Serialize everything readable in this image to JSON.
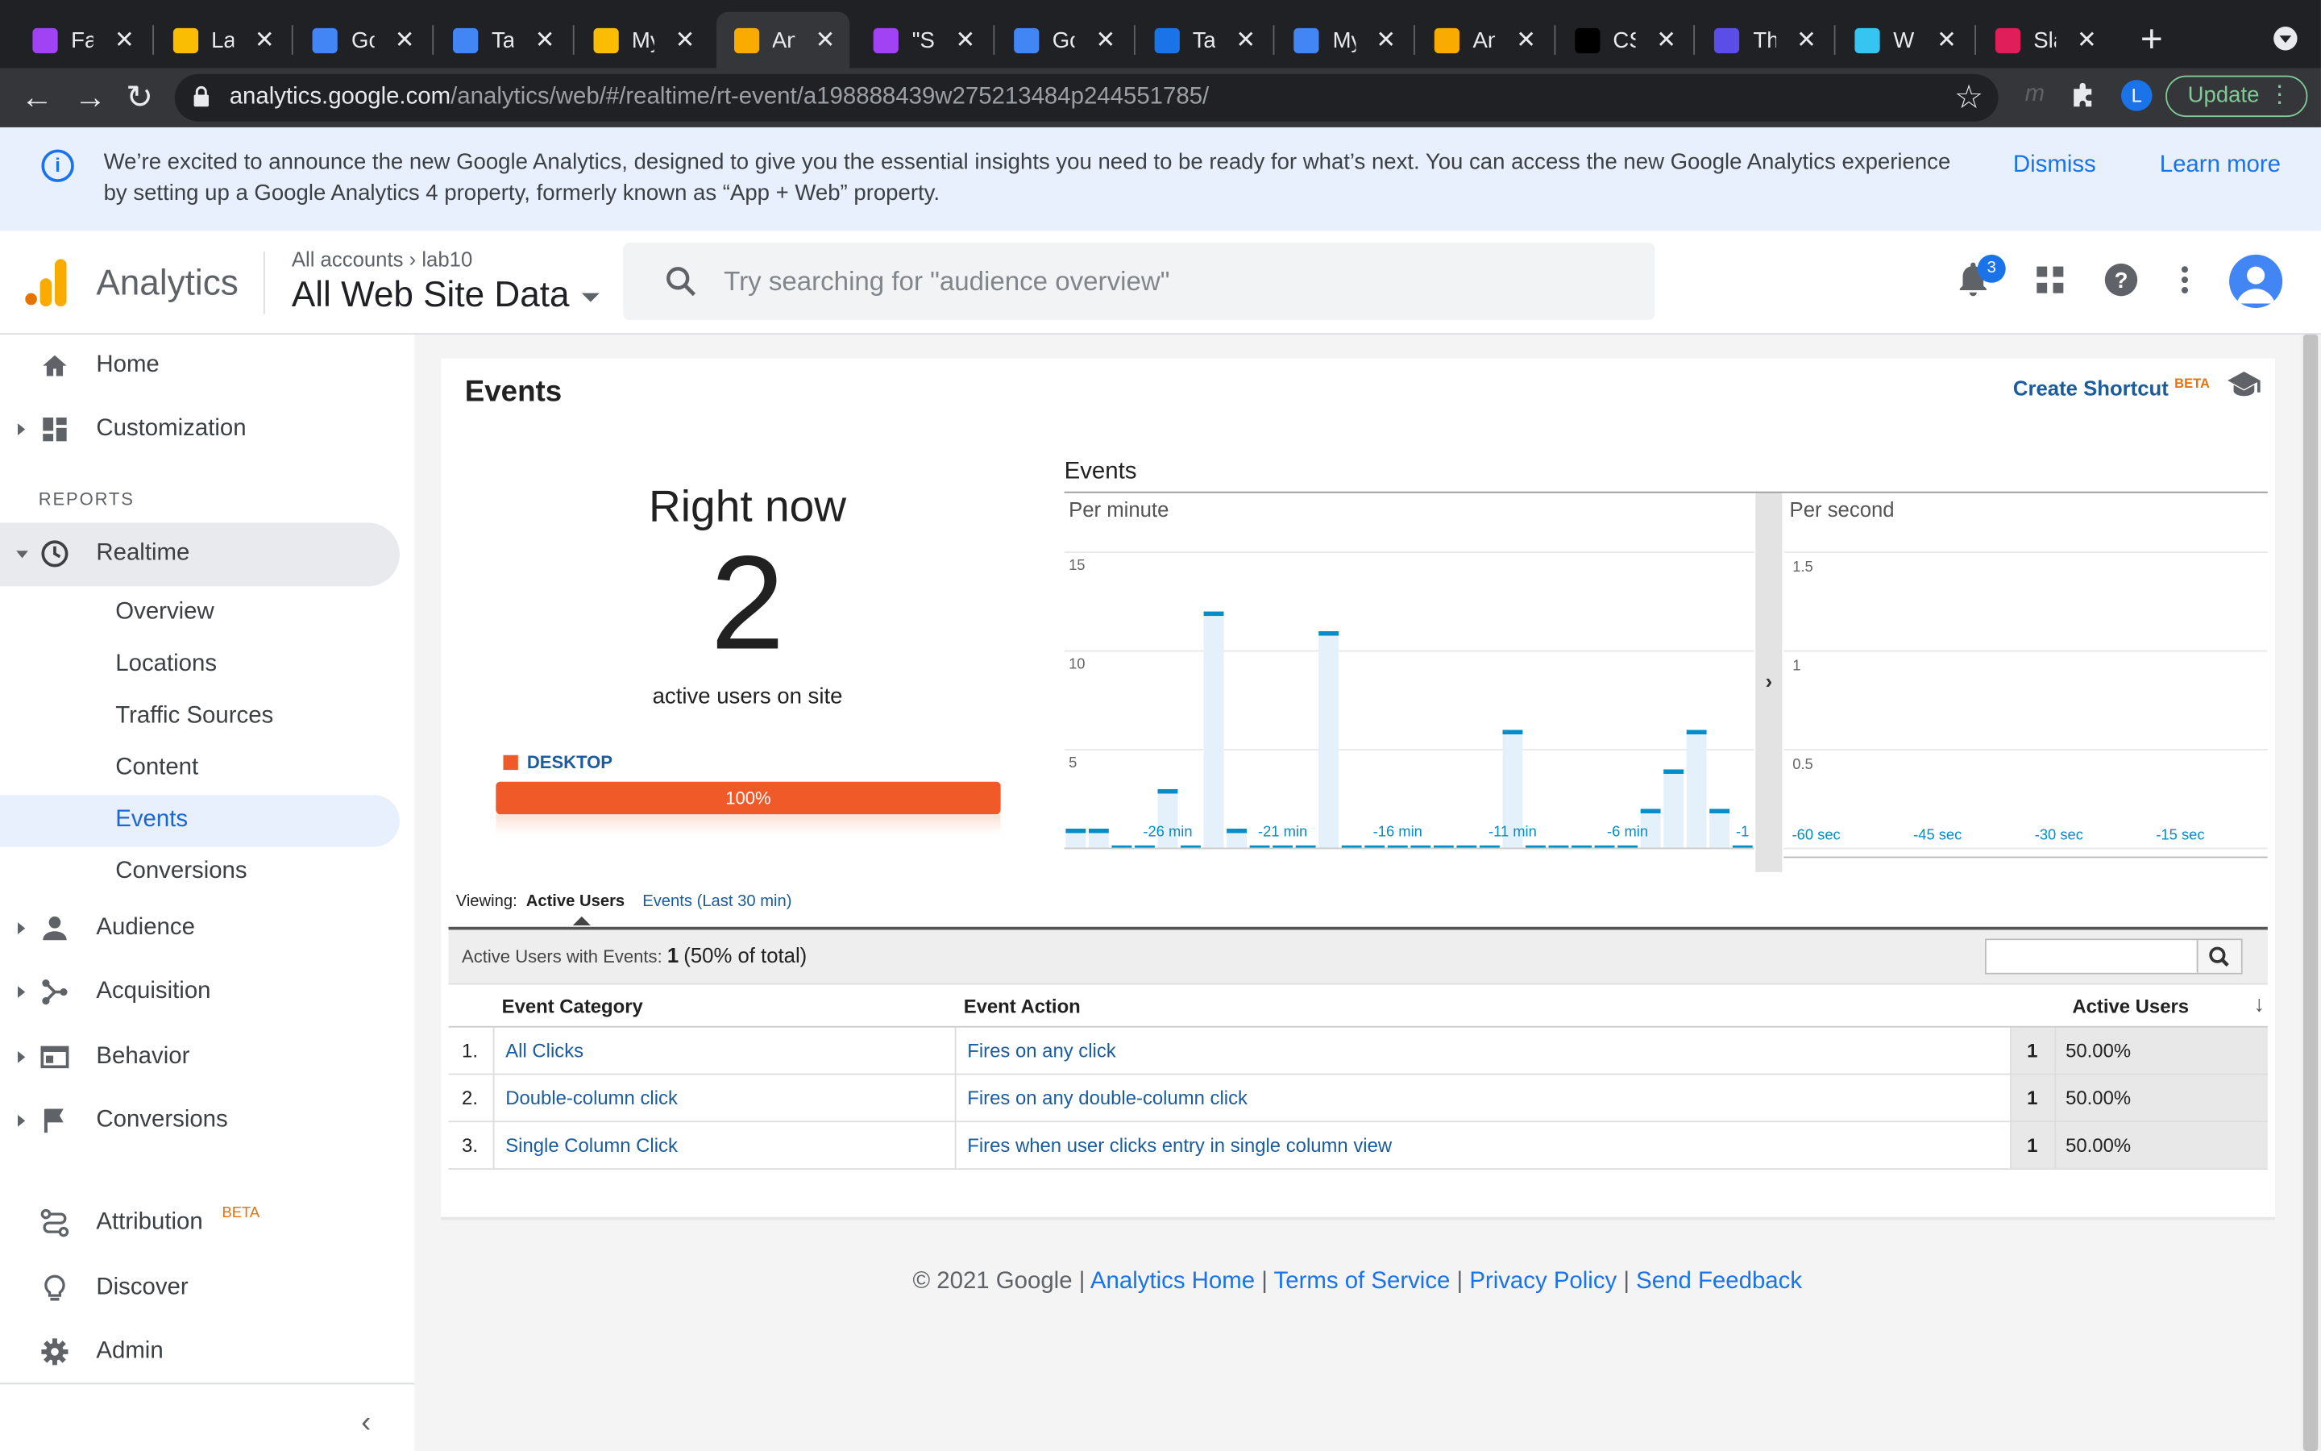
{
  "browser": {
    "tabs": [
      {
        "title": "Favi",
        "color": "#a142f4"
      },
      {
        "title": "Lab",
        "color": "#fbbc04"
      },
      {
        "title": "Goo",
        "color": "#4285f4"
      },
      {
        "title": "Tag",
        "color": "#4285f4"
      },
      {
        "title": "My",
        "color": "#fbbc04"
      },
      {
        "title": "Anal",
        "color": "#f9ab00"
      },
      {
        "title": "\"Sin",
        "color": "#a142f4"
      },
      {
        "title": "Goo",
        "color": "#4285f4"
      },
      {
        "title": "Tag",
        "color": "#1a73e8"
      },
      {
        "title": "My",
        "color": "#4285f4"
      },
      {
        "title": "Anal",
        "color": "#f9ab00"
      },
      {
        "title": "CSS",
        "color": "#000000"
      },
      {
        "title": "The",
        "color": "#5b4de8"
      },
      {
        "title": "Whe",
        "color": "#36c5f0"
      },
      {
        "title": "Slac",
        "color": "#e01e5a"
      }
    ],
    "url_host": "analytics.google.com",
    "url_path": "/analytics/web/#/realtime/rt-event/a198888439w275213484p244551785/",
    "ext_m": "m",
    "profile_letter": "L",
    "update_label": "Update"
  },
  "banner": {
    "message": "We’re excited to announce the new Google Analytics, designed to give you the essential insights you need to be ready for what’s next. You can access the new Google Analytics experience by setting up a Google Analytics 4 property, formerly known as “App + Web” property.",
    "dismiss": "Dismiss",
    "learn_more": "Learn more"
  },
  "header": {
    "app_name": "Analytics",
    "crumb_accounts": "All accounts",
    "crumb_account": "lab10",
    "property": "All Web Site Data",
    "search_placeholder": "Try searching for \"audience overview\"",
    "notifications": "3"
  },
  "sidebar": {
    "home": "Home",
    "customization": "Customization",
    "reports_label": "REPORTS",
    "realtime": "Realtime",
    "sub": [
      "Overview",
      "Locations",
      "Traffic Sources",
      "Content",
      "Events",
      "Conversions"
    ],
    "audience": "Audience",
    "acquisition": "Acquisition",
    "behavior": "Behavior",
    "conversions": "Conversions",
    "attribution": "Attribution",
    "attribution_beta": "BETA",
    "discover": "Discover",
    "admin": "Admin"
  },
  "main": {
    "title": "Events",
    "create_shortcut": "Create Shortcut",
    "beta": "BETA",
    "right_now": "Right now",
    "active_users": "2",
    "active_users_label": "active users on site",
    "device_label": "DESKTOP",
    "device_pct": "100%",
    "device_fraction": 1.0,
    "viewing_label": "Viewing:",
    "viewing_active": "Active Users",
    "viewing_events": "Events (Last 30 min)",
    "summary_label": "Active Users with Events:",
    "summary_value": "1",
    "summary_pct": "(50% of total)",
    "columns": {
      "category": "Event Category",
      "action": "Event Action",
      "users": "Active Users"
    },
    "rows": [
      {
        "n": "1.",
        "category": "All Clicks",
        "action": "Fires on any click",
        "users": "1",
        "pct": "50.00%"
      },
      {
        "n": "2.",
        "category": "Double-column click",
        "action": "Fires on any double-column click",
        "users": "1",
        "pct": "50.00%"
      },
      {
        "n": "3.",
        "category": "Single Column Click",
        "action": "Fires when user clicks entry in single column view",
        "users": "1",
        "pct": "50.00%"
      }
    ]
  },
  "chart_data": [
    {
      "type": "bar",
      "title": "Events",
      "subtitle": "Per minute",
      "x": [
        -30,
        -29,
        -28,
        -27,
        -26,
        -25,
        -24,
        -23,
        -22,
        -21,
        -20,
        -19,
        -18,
        -17,
        -16,
        -15,
        -14,
        -13,
        -12,
        -11,
        -10,
        -9,
        -8,
        -7,
        -6,
        -5,
        -4,
        -3,
        -2,
        -1
      ],
      "values": [
        1,
        1,
        0,
        0,
        3,
        0,
        12,
        1,
        0,
        0,
        0,
        11,
        0,
        0,
        0,
        0,
        0,
        0,
        0,
        6,
        0,
        0,
        0,
        0,
        0,
        2,
        4,
        6,
        2,
        0
      ],
      "tick_labels": [
        "-26 min",
        "-21 min",
        "-16 min",
        "-11 min",
        "-6 min",
        "-1"
      ],
      "y_ticks": [
        "5",
        "10",
        "15"
      ],
      "ylim": [
        0,
        15
      ],
      "color": "#058dc7"
    },
    {
      "type": "bar",
      "subtitle": "Per second",
      "values": [],
      "tick_labels": [
        "-60 sec",
        "-45 sec",
        "-30 sec",
        "-15 sec"
      ],
      "y_ticks": [
        "0.5",
        "1",
        "1.5"
      ],
      "ylim": [
        0,
        1.5
      ]
    }
  ],
  "footer": {
    "copyright": "© 2021 Google",
    "links": [
      "Analytics Home",
      "Terms of Service",
      "Privacy Policy",
      "Send Feedback"
    ]
  }
}
